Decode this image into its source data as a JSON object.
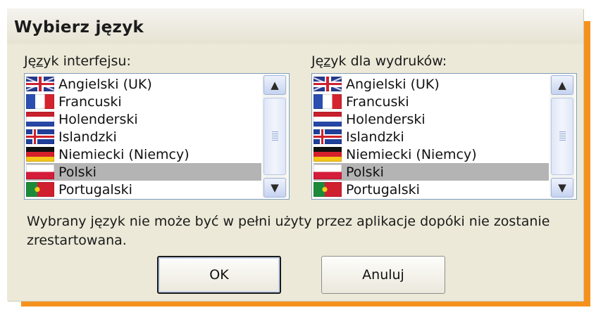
{
  "dialog": {
    "title": "Wybierz język",
    "message": "Wybrany język nie może być w pełni użyty przez aplikacje dopóki nie zostanie zrestartowana.",
    "buttons": {
      "ok": "OK",
      "cancel": "Anuluj"
    }
  },
  "interface_language": {
    "label_prefix": "Ję",
    "label_access_key": "z",
    "label_suffix": "yk interfejsu:",
    "selected": "Polski",
    "items": [
      {
        "label": "Angielski (UK)",
        "flag": "flag-uk-icon"
      },
      {
        "label": "Francuski",
        "flag": "flag-france-icon"
      },
      {
        "label": "Holenderski",
        "flag": "flag-netherlands-icon"
      },
      {
        "label": "Islandzki",
        "flag": "flag-iceland-icon"
      },
      {
        "label": "Niemiecki (Niemcy)",
        "flag": "flag-germany-icon"
      },
      {
        "label": "Polski",
        "flag": "flag-poland-icon"
      },
      {
        "label": "Portugalski",
        "flag": "flag-portugal-icon"
      }
    ]
  },
  "print_language": {
    "label_prefix": "Ję",
    "label_access_key": "z",
    "label_suffix": "yk dla wydruków:",
    "selected": "Polski",
    "items": [
      {
        "label": "Angielski (UK)",
        "flag": "flag-uk-icon"
      },
      {
        "label": "Francuski",
        "flag": "flag-france-icon"
      },
      {
        "label": "Holenderski",
        "flag": "flag-netherlands-icon"
      },
      {
        "label": "Islandzki",
        "flag": "flag-iceland-icon"
      },
      {
        "label": "Niemiecki (Niemcy)",
        "flag": "flag-germany-icon"
      },
      {
        "label": "Polski",
        "flag": "flag-poland-icon"
      },
      {
        "label": "Portugalski",
        "flag": "flag-portugal-icon"
      }
    ]
  },
  "colors": {
    "frame_accent": "#f5921e",
    "dialog_background": "#ece9d8",
    "selection": "#b4b4b4"
  }
}
